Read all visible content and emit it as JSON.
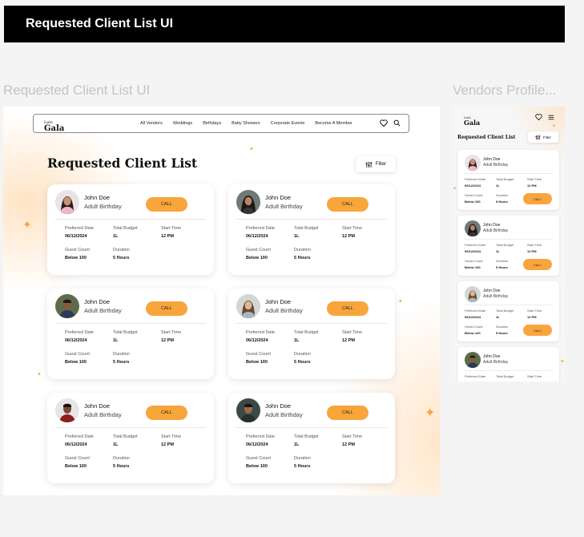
{
  "banner": {
    "title": "Requested Client List UI"
  },
  "frames": {
    "desktop_label": "Requested Client List UI",
    "mobile_label": "Vendors Profile..."
  },
  "logo": {
    "line1": "Lets",
    "line2": "Gala"
  },
  "nav": {
    "links": [
      "All Vendors",
      "Weddings",
      "Birthdays",
      "Baby Showers",
      "Corporate Events",
      "Become A Member"
    ]
  },
  "page": {
    "title": "Requested Client List",
    "filter_label": "Filter"
  },
  "field_labels": {
    "preferred_date": "Preferred Date",
    "total_budget": "Total Budget",
    "start_time": "Start Time",
    "guest_count": "Guest Count",
    "duration": "Duration"
  },
  "call_label": "CALL",
  "clients": [
    {
      "name": "John Doe",
      "event": "Adult Birthday",
      "preferred_date": "06/12/2024",
      "budget": "1L",
      "start_time": "12 PM",
      "guests": "Below 100",
      "duration": "5 Hours"
    },
    {
      "name": "John Doe",
      "event": "Adult Birthday",
      "preferred_date": "06/12/2024",
      "budget": "1L",
      "start_time": "12 PM",
      "guests": "Below 100",
      "duration": "5 Hours"
    },
    {
      "name": "John Doe",
      "event": "Adult Birthday",
      "preferred_date": "06/12/2024",
      "budget": "1L",
      "start_time": "12 PM",
      "guests": "Below 100",
      "duration": "5 Hours"
    },
    {
      "name": "John Doe",
      "event": "Adult Birthday",
      "preferred_date": "06/12/2024",
      "budget": "1L",
      "start_time": "12 PM",
      "guests": "Below 100",
      "duration": "5 Hours"
    },
    {
      "name": "John Doe",
      "event": "Adult Birthday",
      "preferred_date": "06/12/2024",
      "budget": "1L",
      "start_time": "12 PM",
      "guests": "Below 100",
      "duration": "5 Hours"
    },
    {
      "name": "John Doe",
      "event": "Adult Birthday",
      "preferred_date": "06/12/2024",
      "budget": "1L",
      "start_time": "12 PM",
      "guests": "Below 100",
      "duration": "5 Hours"
    }
  ],
  "mobile": {
    "title": "Requested Client List",
    "filter_label": "Filter",
    "clients": [
      {
        "name": "John Doe",
        "event": "Adult Birthday",
        "preferred_date": "06/12/2024",
        "budget": "1L",
        "start_time": "12 PM",
        "guests": "Below 100",
        "duration": "5 Hours"
      },
      {
        "name": "John Doe",
        "event": "Adult Birthday",
        "preferred_date": "06/12/2024",
        "budget": "1L",
        "start_time": "12 PM",
        "guests": "Below 100",
        "duration": "5 Hours"
      },
      {
        "name": "John Doe",
        "event": "Adult Birthday",
        "preferred_date": "06/12/2024",
        "budget": "1L",
        "start_time": "12 PM",
        "guests": "Below 100",
        "duration": "5 Hours"
      },
      {
        "name": "John Doe",
        "event": "Adult Birthday"
      }
    ]
  },
  "colors": {
    "accent": "#f8a53b",
    "banner_bg": "#000000",
    "frame_bg": "#ffffff",
    "canvas_bg": "#f4f4f4"
  },
  "icons": {
    "wishlist": "heart-icon",
    "search": "search-icon",
    "filter": "sliders-icon",
    "menu": "hamburger-menu-icon",
    "sparkle": "sparkle-icon"
  }
}
